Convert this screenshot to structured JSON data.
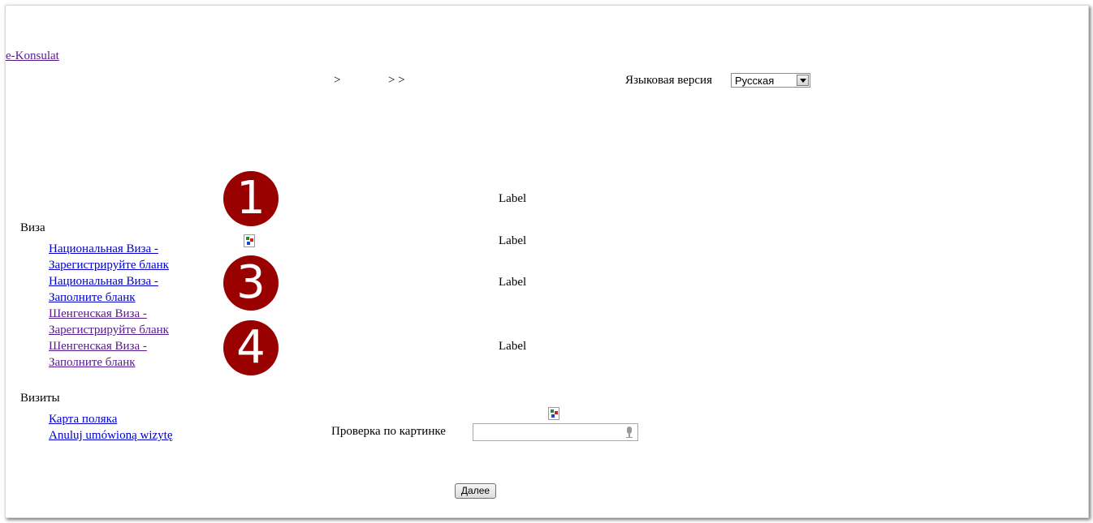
{
  "header": {
    "brand_link": "e-Konsulat",
    "breadcrumb_sep_1": ">",
    "breadcrumb_sep_2": "> >",
    "language_label": "Языковая версия",
    "language_select_value": "Русская"
  },
  "sidebar": {
    "visa_heading": "Виза",
    "visa_links": [
      {
        "line1": "Национальная Виза -",
        "line2": "Зарегистрируйте бланк"
      },
      {
        "line1": "Национальная Виза -",
        "line2": "Заполните бланк"
      },
      {
        "line1": "Шенгенская Виза -",
        "line2": "Зарегистрируйте бланк"
      },
      {
        "line1": "Шенгенская Виза -",
        "line2": "Заполните бланк"
      }
    ],
    "visits_heading": "Визиты",
    "visits_links": [
      {
        "label": "Карта поляка"
      },
      {
        "label": "Anuluj umówioną wizytę"
      }
    ]
  },
  "steps": {
    "step_1": "1",
    "step_3": "3",
    "step_4": "4"
  },
  "labels": [
    "Label",
    "Label",
    "Label",
    "Label"
  ],
  "captcha": {
    "label": "Проверка по картинке",
    "input_value": ""
  },
  "actions": {
    "next_button": "Далее"
  },
  "colors": {
    "step_circle": "#990000",
    "link": "#0000cc",
    "visited_link": "#551a8b"
  }
}
